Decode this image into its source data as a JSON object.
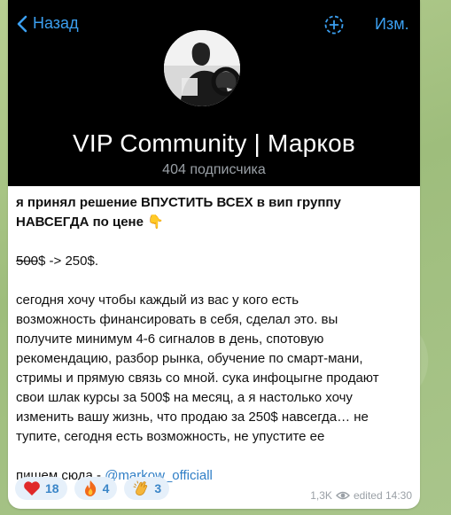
{
  "header": {
    "back_label": "Назад",
    "edit_label": "Изм.",
    "channel_name": "VIP Community | Марков",
    "subscribers": "404 подписчика"
  },
  "post": {
    "line1": "я принял решение ВПУСТИТЬ ВСЕХ в вип группу",
    "line2": "НАВСЕГДА  по цене 👇",
    "old_price": "500",
    "price_rest": "$ -> 250$.",
    "paragraph": [
      "сегодня хочу чтобы каждый из вас у кого есть",
      "возможность финансировать в себя, сделал это. вы",
      "получите минимум 4-6 сигналов в день, спотовую",
      "рекомендацию, разбор рынка, обучение по смарт-мани,",
      "стримы и прямую связь со мной. сука инфоцыгне продают",
      "свои шлак курсы за 500$ на месяц, а я настолько хочу",
      "изменить вашу жизнь, что продаю за 250$ навсегда… не",
      "тупите, сегодня есть возможность, не упустите ее"
    ],
    "contact_prefix": "пишем сюда - ",
    "contact_link": "@markow_officiall"
  },
  "reactions": [
    {
      "emoji": "heart",
      "count": "18"
    },
    {
      "emoji": "fire",
      "count": "4"
    },
    {
      "emoji": "clap",
      "count": "3"
    }
  ],
  "meta": {
    "views": "1,3K",
    "edited": "edited 14:30"
  },
  "colors": {
    "accent": "#3b9ff0",
    "link": "#2f7ec6",
    "header_bg": "#000000"
  }
}
